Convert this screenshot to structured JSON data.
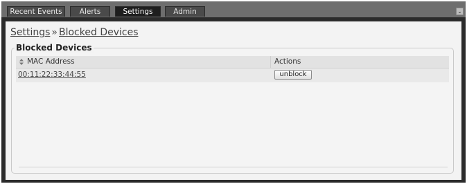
{
  "tabs": [
    {
      "label": "Recent Events",
      "active": false
    },
    {
      "label": "Alerts",
      "active": false
    },
    {
      "label": "Settings",
      "active": true
    },
    {
      "label": "Admin",
      "active": false
    }
  ],
  "collapse_icon": "chevron-down-icon",
  "breadcrumb": {
    "parent": "Settings",
    "separator": "»",
    "current": "Blocked Devices"
  },
  "blocked_devices": {
    "legend": "Blocked Devices",
    "columns": {
      "mac": "MAC Address",
      "actions": "Actions"
    },
    "rows": [
      {
        "mac": "00:11:22:33:44:55",
        "action_label": "unblock"
      }
    ]
  }
}
